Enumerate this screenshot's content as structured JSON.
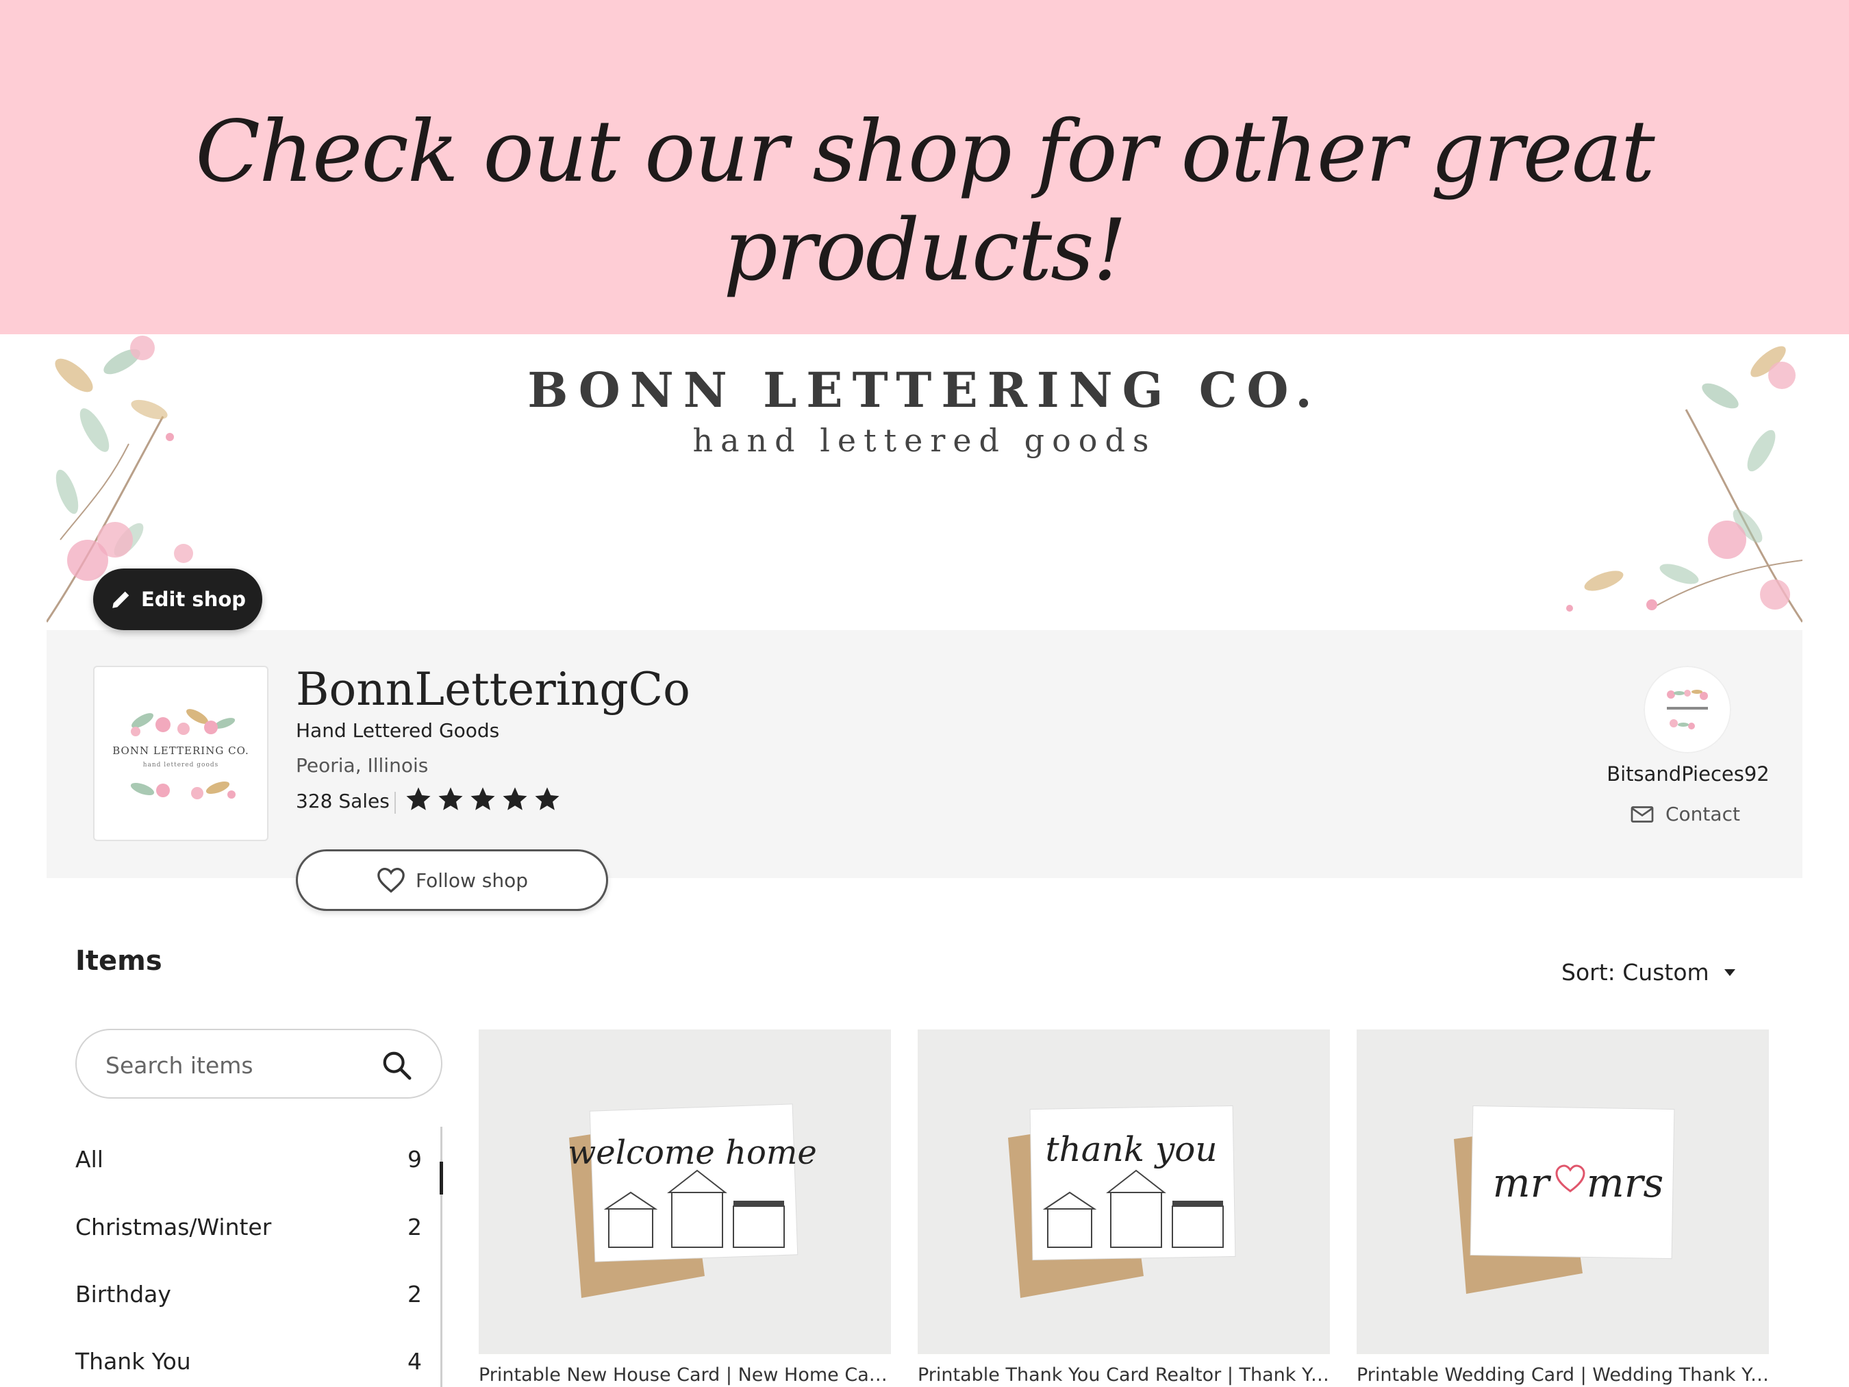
{
  "promo": {
    "headline": "Check out our shop for other great products!"
  },
  "cover": {
    "title": "BONN LETTERING CO.",
    "subtitle": "hand lettered goods"
  },
  "edit_shop": {
    "label": "Edit shop",
    "icon": "pencil-icon"
  },
  "shop": {
    "logo_title": "BONN LETTERING CO.",
    "logo_subtitle": "hand lettered goods",
    "name": "BonnLetteringCo",
    "tagline": "Hand Lettered Goods",
    "location": "Peoria, Illinois",
    "sales": "328 Sales",
    "rating": 5,
    "follow_label": "Follow shop"
  },
  "owner": {
    "name": "BitsandPieces92",
    "contact_label": "Contact",
    "avatar_title": "BONN LETTERING CO."
  },
  "items": {
    "heading": "Items",
    "sort_label": "Sort: Custom",
    "search_placeholder": "Search items",
    "categories": [
      {
        "label": "All",
        "count": "9",
        "active": true
      },
      {
        "label": "Christmas/Winter",
        "count": "2"
      },
      {
        "label": "Birthday",
        "count": "2"
      },
      {
        "label": "Thank You",
        "count": "4"
      }
    ],
    "listings": [
      {
        "card_text": "welcome home",
        "title": "Printable New House Card | New Home Card | Housewarming Card"
      },
      {
        "card_text": "thank you",
        "title": "Printable Thank You Card Realtor | Thank You Card for Clients"
      },
      {
        "card_text_left": "mr",
        "card_text_right": "mrs",
        "title": "Printable Wedding Card | Wedding Thank You Card"
      }
    ]
  },
  "colors": {
    "promo_bg": "#fecdd5",
    "edit_button": "#1f1f1f",
    "info_bg": "#f5f5f5",
    "heart_accent": "#e0566c"
  }
}
